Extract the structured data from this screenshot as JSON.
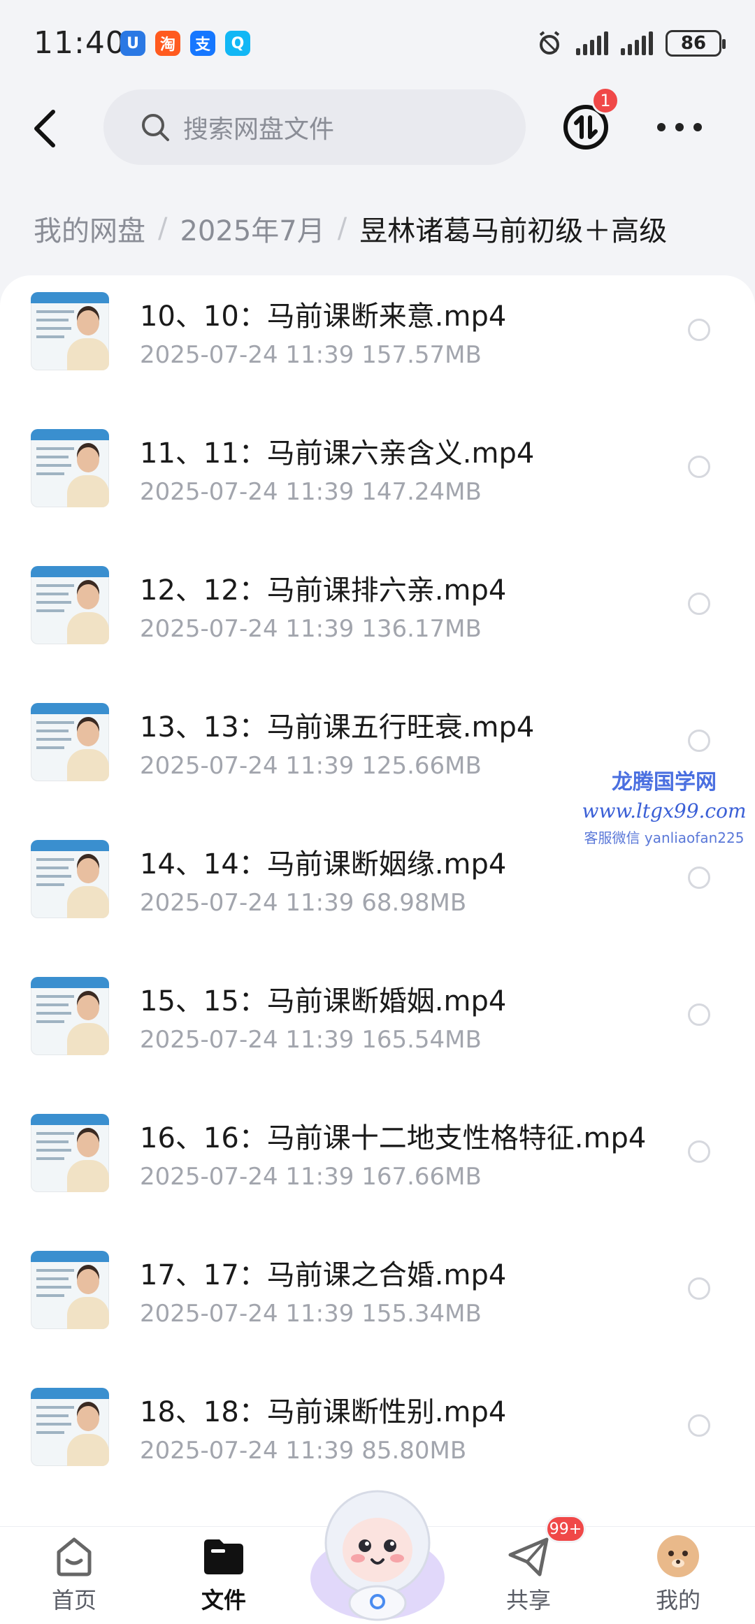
{
  "status_bar": {
    "time": "11:40",
    "apps": [
      {
        "glyph": "U",
        "color": "#2a78e4",
        "icon": "browser-app-icon"
      },
      {
        "glyph": "淘",
        "color": "#ff5a1f",
        "icon": "taobao-app-icon"
      },
      {
        "glyph": "支",
        "color": "#1677ff",
        "icon": "alipay-app-icon"
      },
      {
        "glyph": "Q",
        "color": "#12b7f5",
        "icon": "search-app-icon"
      }
    ],
    "battery": "86"
  },
  "header": {
    "search_placeholder": "搜索网盘文件",
    "transfer_badge": "1"
  },
  "breadcrumb": {
    "items": [
      "我的网盘",
      "2025年7月"
    ],
    "current": "昱林诸葛马前初级＋高级"
  },
  "files": [
    {
      "name": "10、10：马前课断来意.mp4",
      "meta": "2025-07-24  11:39   157.57MB"
    },
    {
      "name": "11、11：马前课六亲含义.mp4",
      "meta": "2025-07-24  11:39   147.24MB"
    },
    {
      "name": "12、12：马前课排六亲.mp4",
      "meta": "2025-07-24  11:39   136.17MB"
    },
    {
      "name": "13、13：马前课五行旺衰.mp4",
      "meta": "2025-07-24  11:39   125.66MB"
    },
    {
      "name": "14、14：马前课断姻缘.mp4",
      "meta": "2025-07-24  11:39   68.98MB"
    },
    {
      "name": "15、15：马前课断婚姻.mp4",
      "meta": "2025-07-24  11:39   165.54MB"
    },
    {
      "name": "16、16：马前课十二地支性格特征.mp4",
      "meta": "2025-07-24  11:39   167.66MB"
    },
    {
      "name": "17、17：马前课之合婚.mp4",
      "meta": "2025-07-24  11:39   155.34MB"
    },
    {
      "name": "18、18：马前课断性别.mp4",
      "meta": "2025-07-24  11:39   85.80MB"
    }
  ],
  "watermark": {
    "title": "龙腾国学网",
    "url": "www.ltgx99.com",
    "contact": "客服微信 yanliaofan225"
  },
  "bottom_nav": {
    "home": "首页",
    "files": "文件",
    "share": "共享",
    "share_badge": "99+",
    "mine": "我的"
  }
}
